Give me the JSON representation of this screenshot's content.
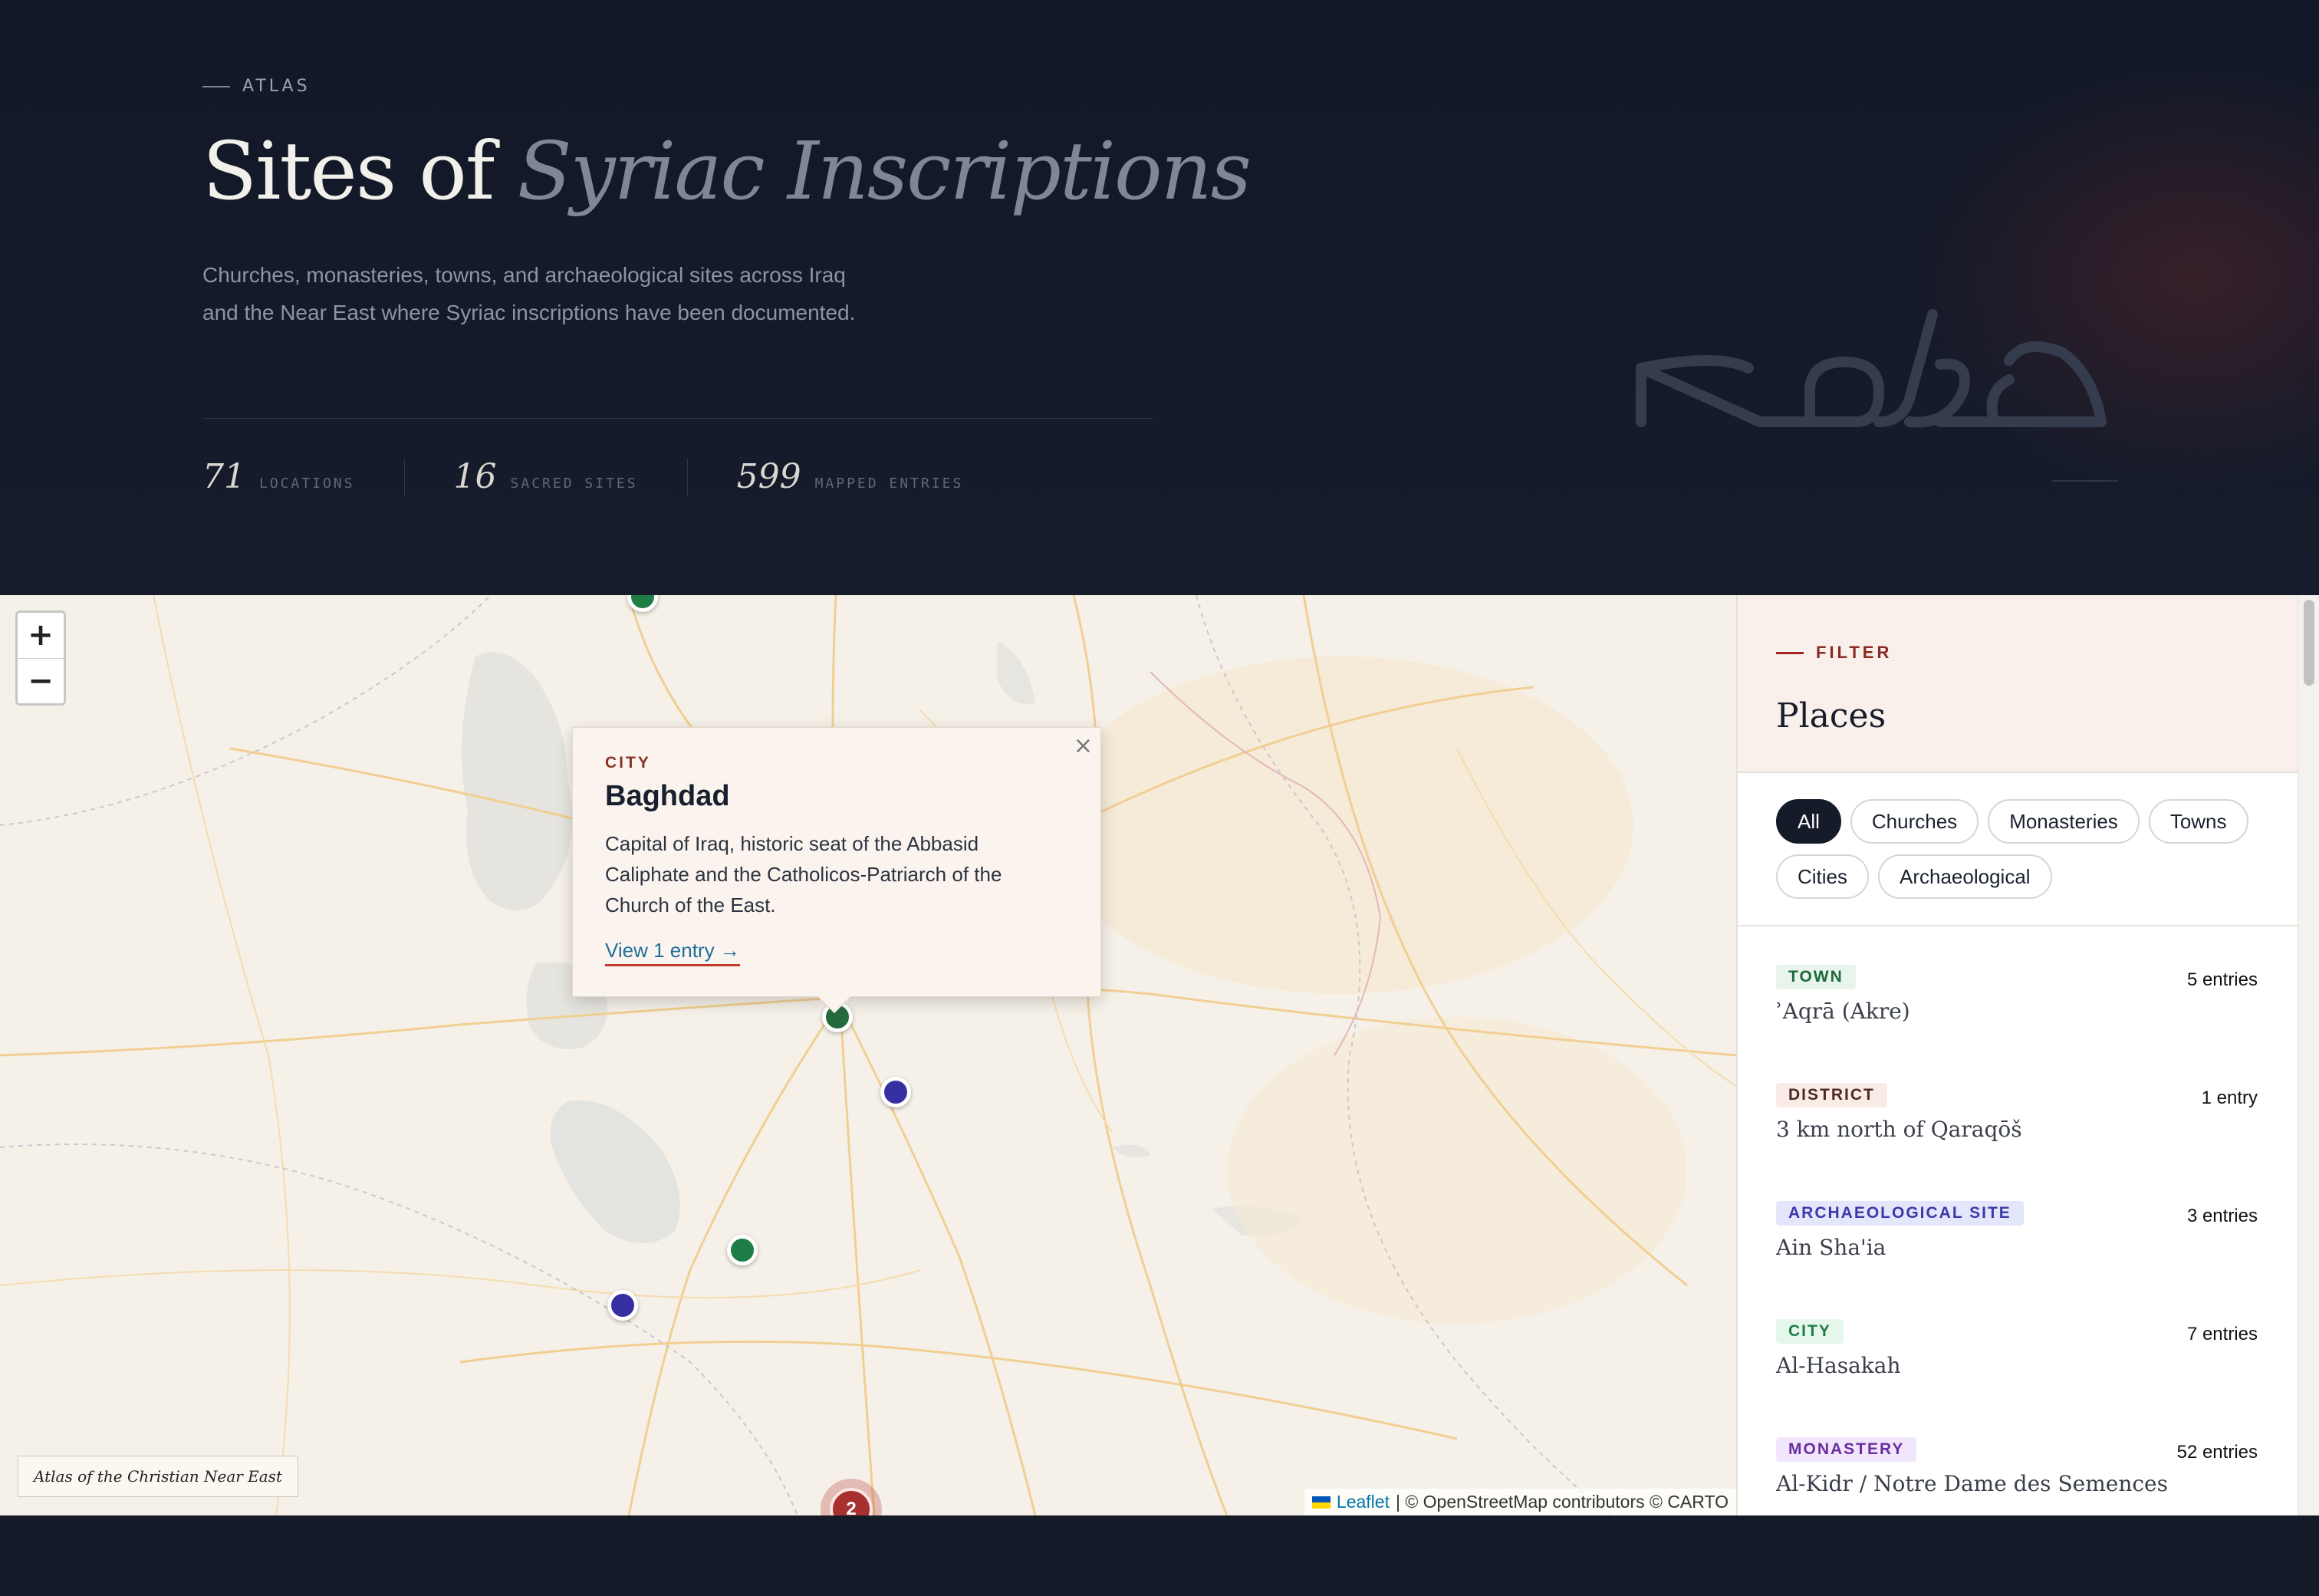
{
  "hero": {
    "eyebrow": "ATLAS",
    "title_plain": "Sites of",
    "title_emphasis": "Syriac Inscriptions",
    "subtitle": "Churches, monasteries, towns, and archaeological sites across Iraq and the Near East where Syriac inscriptions have been documented.",
    "stats": [
      {
        "value": "71",
        "label": "LOCATIONS"
      },
      {
        "value": "16",
        "label": "SACRED SITES"
      },
      {
        "value": "599",
        "label": "MAPPED ENTRIES"
      }
    ]
  },
  "map": {
    "zoom_in": "+",
    "zoom_out": "−",
    "atlas_tag": "Atlas of the Christian Near East",
    "attribution_link": "Leaflet",
    "attribution_text": "| © OpenStreetMap contributors © CARTO",
    "cluster_count": "2",
    "popup": {
      "close": "×",
      "type": "CITY",
      "name": "Baghdad",
      "description": "Capital of Iraq, historic seat of the Abbasid Caliphate and the Catholicos-Patriarch of the Church of the East.",
      "link": "View 1 entry →"
    }
  },
  "sidebar": {
    "eyebrow": "FILTER",
    "title": "Places",
    "filters": [
      "All",
      "Churches",
      "Monasteries",
      "Towns",
      "Cities",
      "Archaeological"
    ],
    "active_filter": "All",
    "places": [
      {
        "type": "TOWN",
        "name": "ʾAqrā (Akre)",
        "count": "5 entries"
      },
      {
        "type": "DISTRICT",
        "name": "3 km north of Qaraqōš",
        "count": "1 entry"
      },
      {
        "type": "ARCHAEOLOGICAL SITE",
        "name": "Ain Sha'ia",
        "count": "3 entries"
      },
      {
        "type": "CITY",
        "name": "Al-Hasakah",
        "count": "7 entries"
      },
      {
        "type": "MONASTERY",
        "name": "Al-Kidr / Notre Dame des Semences",
        "count": "52 entries"
      }
    ]
  },
  "colors": {
    "hero_bg": "#121827",
    "accent_red": "#a3231f",
    "city_marker": "#1e7d45",
    "archaeological_marker": "#3730a3",
    "cluster": "#a8302f",
    "map_bg": "#f5f1e8"
  },
  "icons": {
    "close": "close-icon",
    "syriac_mark": "syriac-script-mark",
    "flag": "ukraine-flag-icon"
  }
}
